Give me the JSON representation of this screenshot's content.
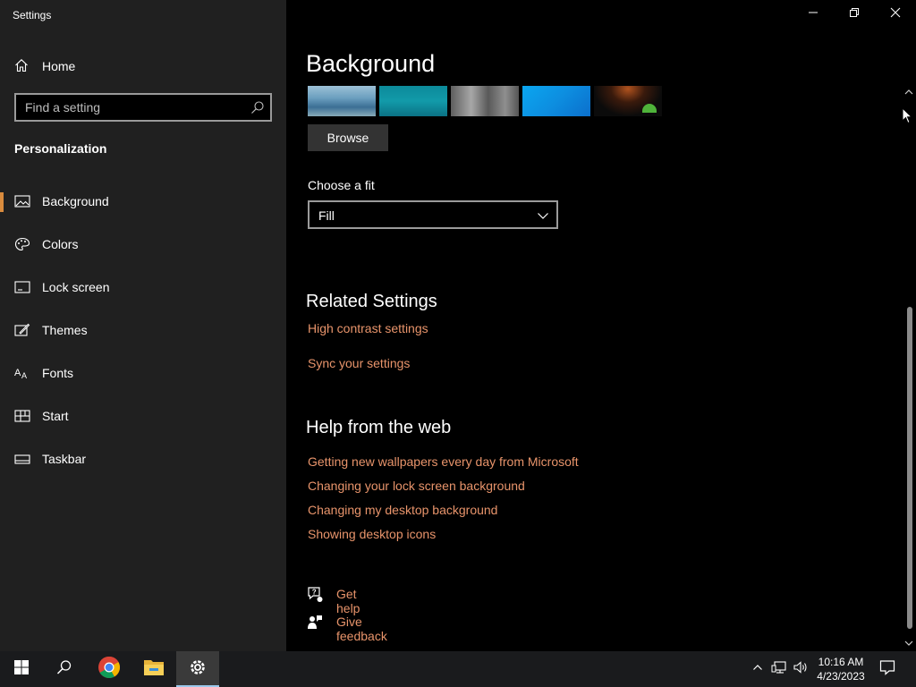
{
  "window": {
    "title": "Settings",
    "controls": {
      "minimize": "minimize-icon",
      "maximize": "restore-icon",
      "close": "close-icon"
    }
  },
  "sidebar": {
    "home_label": "Home",
    "search_placeholder": "Find a setting",
    "section_title": "Personalization",
    "items": [
      {
        "label": "Background",
        "icon": "image-icon",
        "active": true
      },
      {
        "label": "Colors",
        "icon": "palette-icon",
        "active": false
      },
      {
        "label": "Lock screen",
        "icon": "lock-screen-icon",
        "active": false
      },
      {
        "label": "Themes",
        "icon": "themes-icon",
        "active": false
      },
      {
        "label": "Fonts",
        "icon": "fonts-icon",
        "active": false
      },
      {
        "label": "Start",
        "icon": "start-icon",
        "active": false
      },
      {
        "label": "Taskbar",
        "icon": "taskbar-icon",
        "active": false
      }
    ],
    "accent_color": "#d98b3d"
  },
  "main": {
    "title": "Background",
    "browse_label": "Browse",
    "fit": {
      "label": "Choose a fit",
      "value": "Fill"
    },
    "related": {
      "heading": "Related Settings",
      "links": [
        "High contrast settings",
        "Sync your settings"
      ]
    },
    "help": {
      "heading": "Help from the web",
      "links": [
        "Getting new wallpapers every day from Microsoft",
        "Changing your lock screen background",
        "Changing my desktop background",
        "Showing desktop icons"
      ]
    },
    "support": {
      "get_help": "Get help",
      "give_feedback": "Give feedback"
    },
    "link_color": "#e8946b"
  },
  "taskbar": {
    "apps": [
      "start-icon",
      "search-icon",
      "chrome-icon",
      "file-explorer-icon",
      "settings-icon"
    ],
    "clock": {
      "time": "10:16 AM",
      "date": "4/23/2023"
    }
  }
}
